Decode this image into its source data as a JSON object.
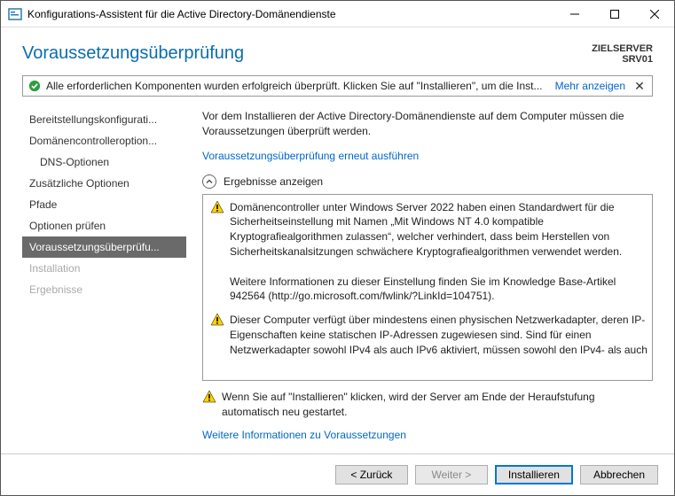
{
  "window": {
    "title": "Konfigurations-Assistent für die Active Directory-Domänendienste"
  },
  "header": {
    "page_title": "Voraussetzungsüberprüfung",
    "target_label": "ZIELSERVER",
    "target_value": "SRV01"
  },
  "banner": {
    "message": "Alle erforderlichen Komponenten wurden erfolgreich überprüft. Klicken Sie auf \"Installieren\", um die Inst...",
    "more": "Mehr anzeigen"
  },
  "sidebar": {
    "items": [
      {
        "label": "Bereitstellungskonfigurati...",
        "state": "normal"
      },
      {
        "label": "Domänencontrolleroption...",
        "state": "normal"
      },
      {
        "label": "DNS-Optionen",
        "state": "indent"
      },
      {
        "label": "Zusätzliche Optionen",
        "state": "normal"
      },
      {
        "label": "Pfade",
        "state": "normal"
      },
      {
        "label": "Optionen prüfen",
        "state": "normal"
      },
      {
        "label": "Voraussetzungsüberprüfu...",
        "state": "active"
      },
      {
        "label": "Installation",
        "state": "disabled"
      },
      {
        "label": "Ergebnisse",
        "state": "disabled"
      }
    ]
  },
  "main": {
    "intro": "Vor dem Installieren der Active Directory-Domänendienste auf dem Computer müssen die Voraussetzungen überprüft werden.",
    "rerun_link": "Voraussetzungsüberprüfung erneut ausführen",
    "expander_label": "Ergebnisse anzeigen",
    "results": [
      "Domänencontroller unter Windows Server 2022 haben einen Standardwert für die Sicherheitseinstellung mit Namen „Mit Windows NT 4.0 kompatible Kryptografiealgorithmen zulassen“, welcher verhindert, dass beim Herstellen von Sicherheitskanalsitzungen schwächere Kryptografiealgorithmen verwendet werden.\n\nWeitere Informationen zu dieser Einstellung finden Sie im Knowledge Base-Artikel 942564 (http://go.microsoft.com/fwlink/?LinkId=104751).",
      "Dieser Computer verfügt über mindestens einen physischen Netzwerkadapter, deren IP-Eigenschaften keine statischen IP-Adressen zugewiesen sind. Sind für einen Netzwerkadapter sowohl IPv4 als auch IPv6 aktiviert, müssen sowohl den IPv4- als auch"
    ],
    "footer_warning": "Wenn Sie auf \"Installieren\" klicken, wird der Server am Ende der Heraufstufung automatisch neu gestartet.",
    "more_info_link": "Weitere Informationen zu Voraussetzungen"
  },
  "buttons": {
    "back": "< Zurück",
    "next": "Weiter >",
    "install": "Installieren",
    "cancel": "Abbrechen"
  }
}
